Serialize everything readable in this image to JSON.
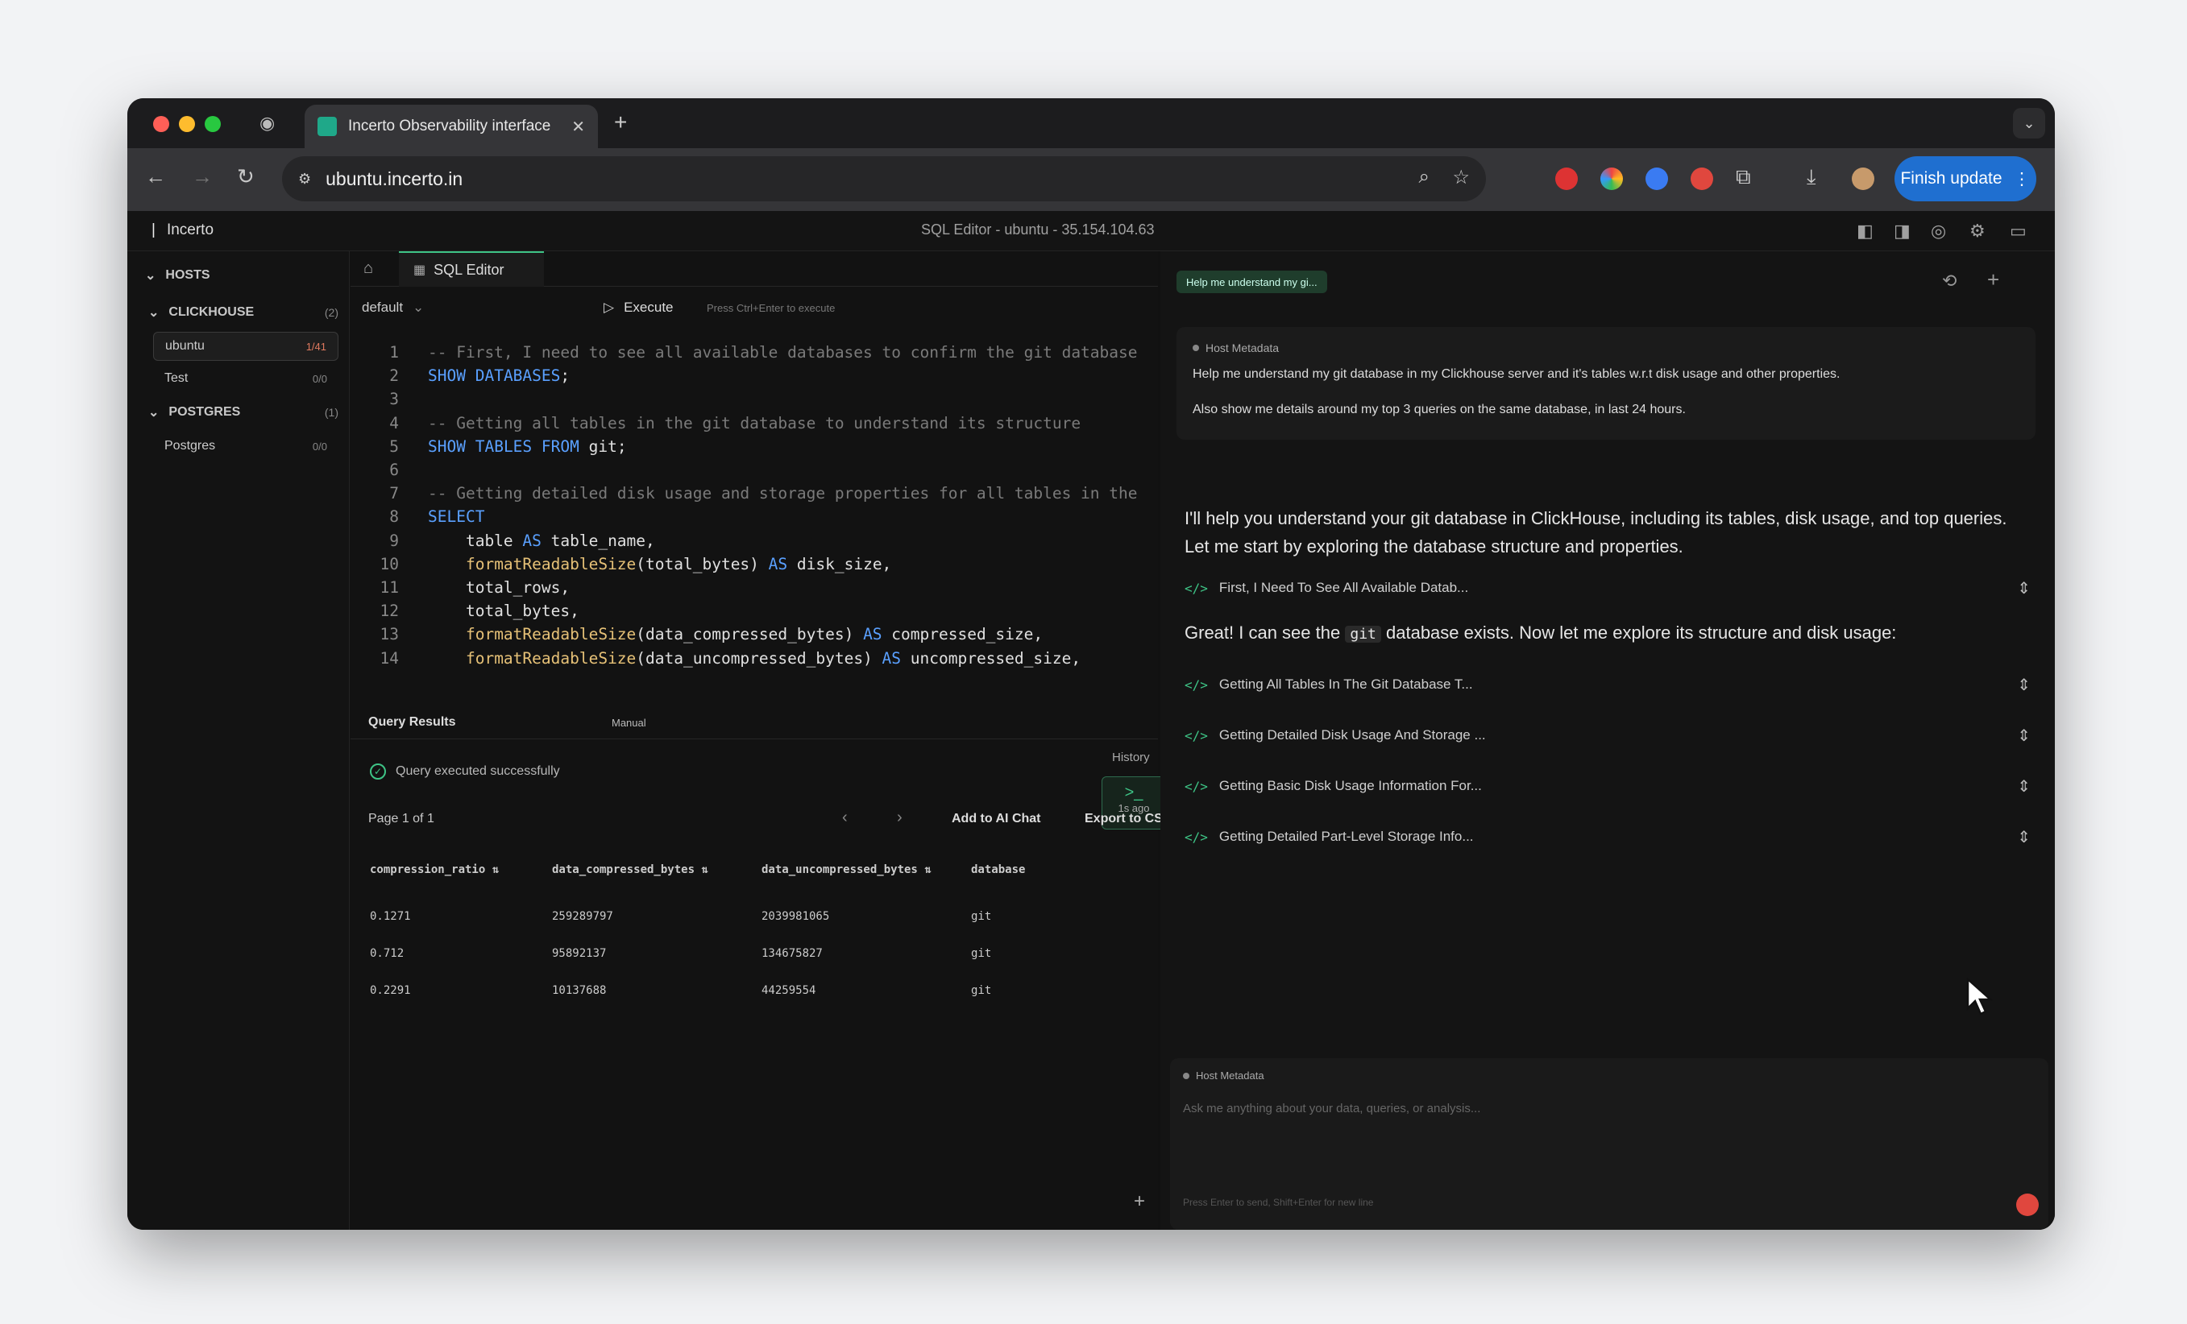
{
  "browser": {
    "tab_title": "Incerto Observability interface",
    "url": "ubuntu.incerto.in",
    "finish_update": "Finish update"
  },
  "app": {
    "brand": "Incerto",
    "center_title": "SQL Editor - ubuntu - 35.154.104.63"
  },
  "sidebar": {
    "hosts_label": "HOSTS",
    "sections": [
      {
        "name": "CLICKHOUSE",
        "count": "(2)",
        "hosts": [
          {
            "name": "ubuntu",
            "count": "1/41"
          },
          {
            "name": "Test",
            "count": "0/0"
          }
        ]
      },
      {
        "name": "POSTGRES",
        "count": "(1)",
        "hosts": [
          {
            "name": "Postgres",
            "count": "0/0"
          }
        ]
      }
    ]
  },
  "editor": {
    "tab_label": "SQL Editor",
    "db_select": "default",
    "execute_label": "Execute",
    "execute_hint": "Press Ctrl+Enter to execute",
    "lines": [
      {
        "n": "1",
        "text": "-- First, I need to see all available databases to confirm the git database"
      },
      {
        "n": "2",
        "text": "SHOW DATABASES;"
      },
      {
        "n": "3",
        "text": ""
      },
      {
        "n": "4",
        "text": "-- Getting all tables in the git database to understand its structure"
      },
      {
        "n": "5",
        "text": "SHOW TABLES FROM git;"
      },
      {
        "n": "6",
        "text": ""
      },
      {
        "n": "7",
        "text": "-- Getting detailed disk usage and storage properties for all tables in the"
      },
      {
        "n": "8",
        "text": "SELECT"
      },
      {
        "n": "9",
        "text": "    table AS table_name,"
      },
      {
        "n": "10",
        "text": "    formatReadableSize(total_bytes) AS disk_size,"
      },
      {
        "n": "11",
        "text": "    total_rows,"
      },
      {
        "n": "12",
        "text": "    total_bytes,"
      },
      {
        "n": "13",
        "text": "    formatReadableSize(data_compressed_bytes) AS compressed_size,"
      },
      {
        "n": "14",
        "text": "    formatReadableSize(data_uncompressed_bytes) AS uncompressed_size,"
      }
    ]
  },
  "results": {
    "tab_results": "Query Results",
    "tab_manual": "Manual",
    "status": "Query executed successfully",
    "history_label": "History",
    "history_time": "1s ago",
    "page": "Page 1 of 1",
    "add_to_chat": "Add to AI Chat",
    "export_csv": "Export to CSV",
    "columns": [
      "compression_ratio",
      "data_compressed_bytes",
      "data_uncompressed_bytes",
      "database"
    ],
    "rows": [
      [
        "0.1271",
        "259289797",
        "2039981065",
        "git"
      ],
      [
        "0.712",
        "95892137",
        "134675827",
        "git"
      ],
      [
        "0.2291",
        "10137688",
        "44259554",
        "git"
      ]
    ],
    "sort_icon": "sort-icon"
  },
  "chat": {
    "chip": "Help me understand my gi...",
    "metadata_label": "Host Metadata",
    "user_msg_1": "Help me understand my git database in my Clickhouse server and it's tables w.r.t disk usage and other properties.",
    "user_msg_2": "Also show me details around my top 3 queries on the same database, in last 24 hours.",
    "reply_1": "I'll help you understand your git database in ClickHouse, including its tables, disk usage, and top queries. Let me start by exploring the database structure and properties.",
    "step_1": "First, I Need To See All Available Datab...",
    "reply_2_pre": "Great! I can see the",
    "reply_2_code": "git",
    "reply_2_post": "database exists. Now let me explore its structure and disk usage:",
    "steps": [
      "Getting All Tables In The Git Database T...",
      "Getting Detailed Disk Usage And Storage ...",
      "Getting Basic Disk Usage Information For...",
      "Getting Detailed Part-Level Storage Info..."
    ],
    "input_metadata": "Host Metadata",
    "input_placeholder": "Ask me anything about your data, queries, or analysis...",
    "input_hint": "Press Enter to send, Shift+Enter for new line"
  },
  "colors": {
    "accent_green": "#3ec486",
    "finish_blue": "#1f6fd0"
  }
}
